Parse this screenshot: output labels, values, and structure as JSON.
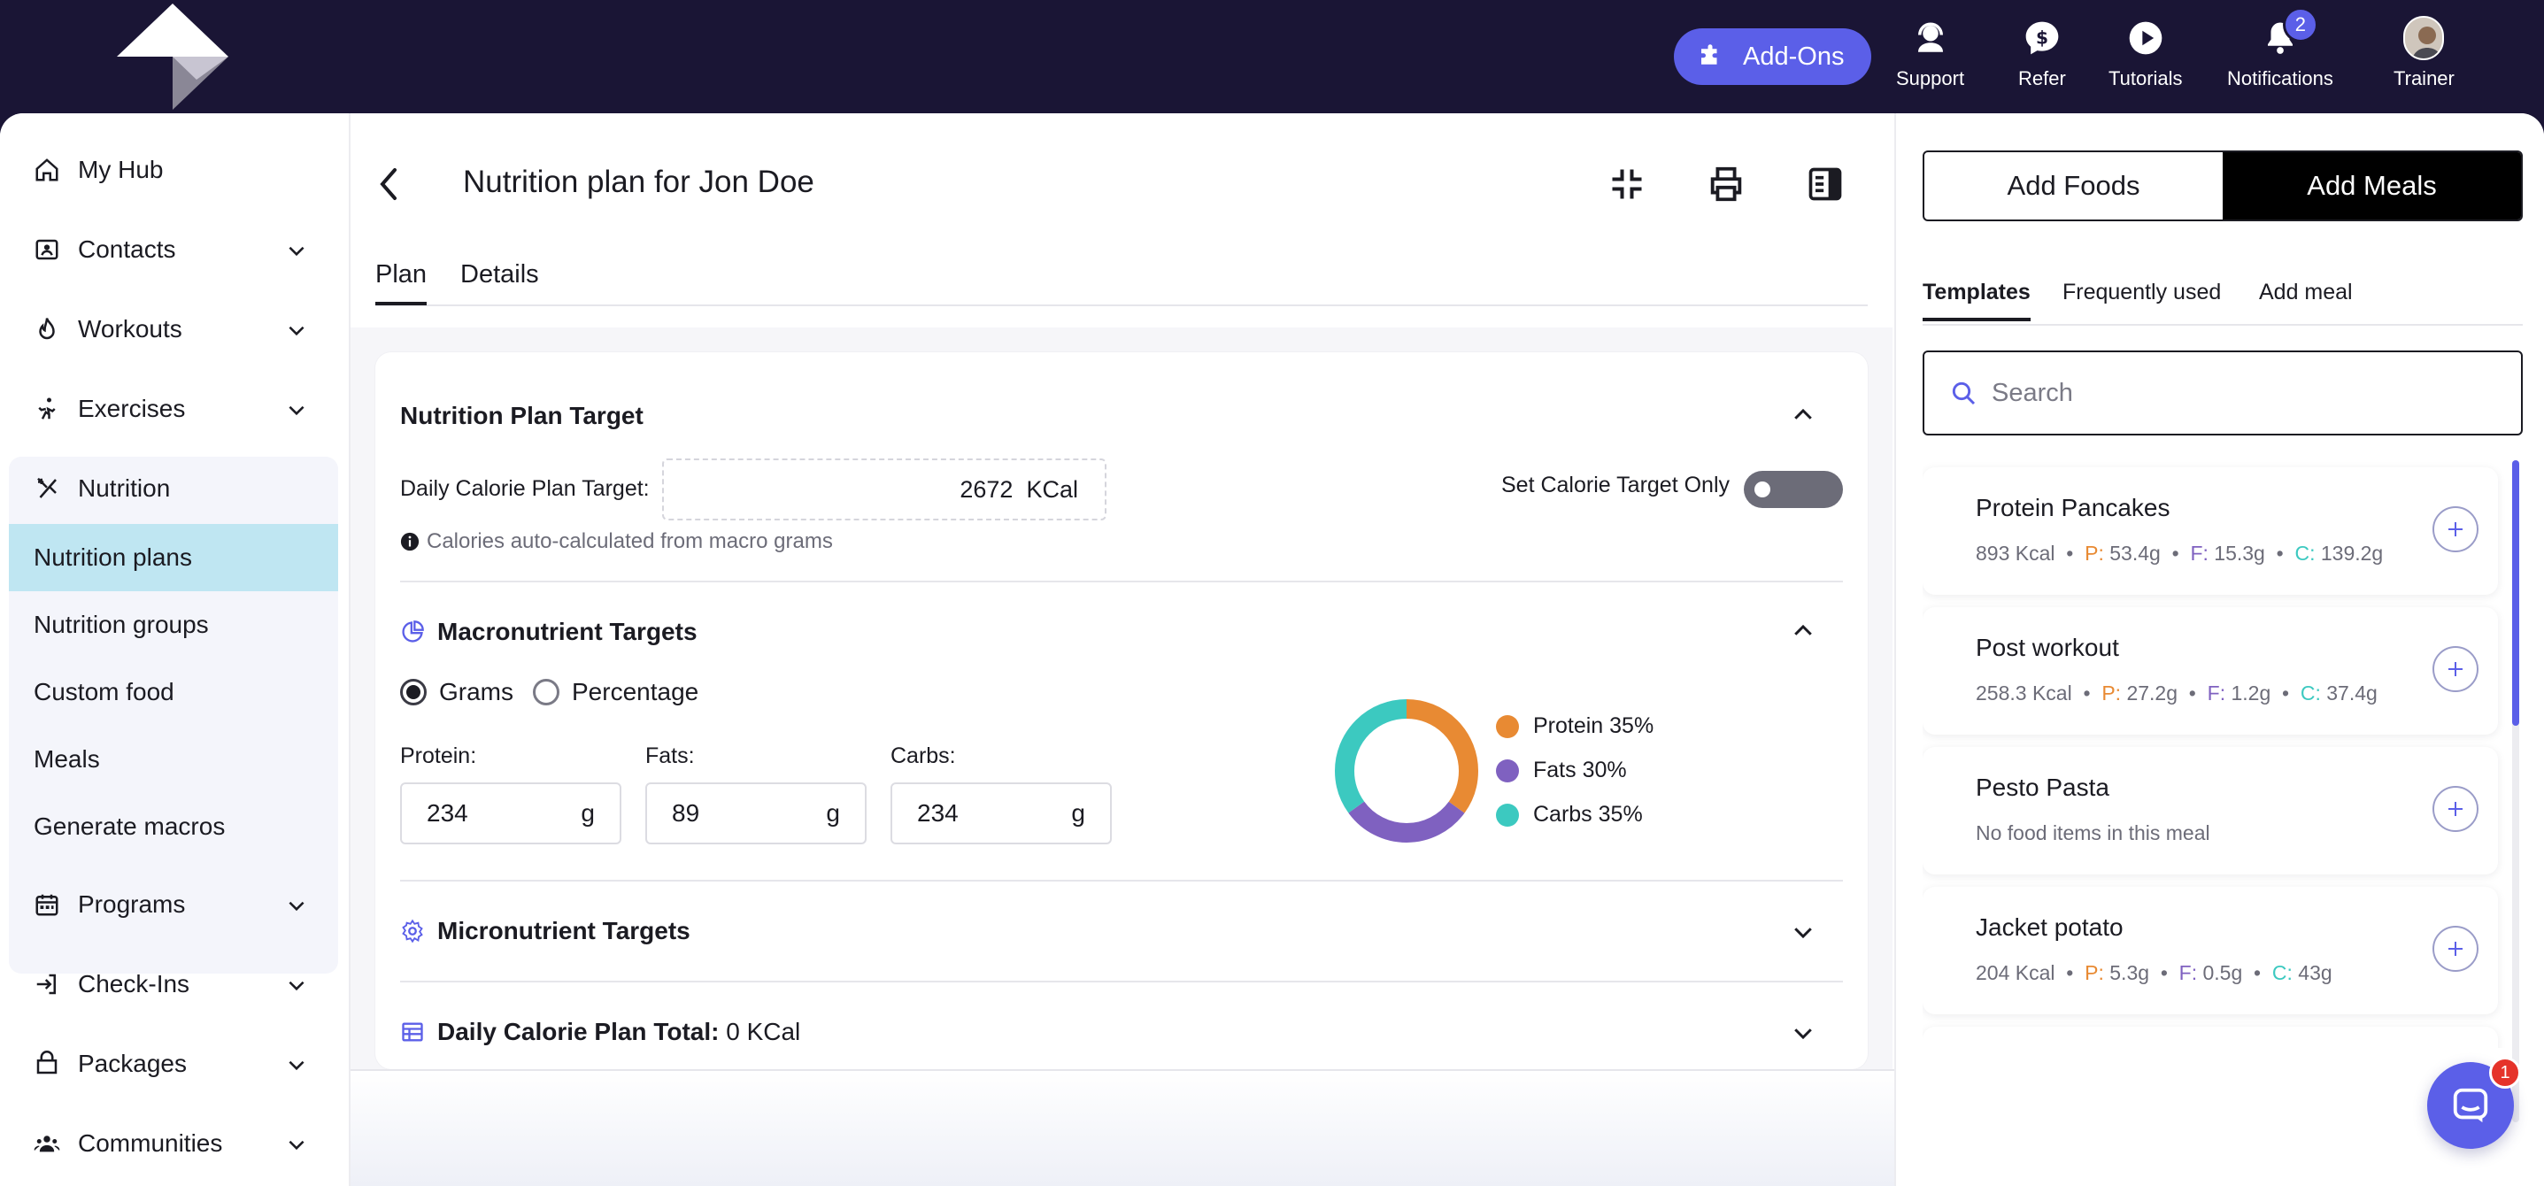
{
  "topbar": {
    "addons_label": "Add-Ons",
    "nav": [
      {
        "label": "Support"
      },
      {
        "label": "Refer"
      },
      {
        "label": "Tutorials"
      },
      {
        "label": "Notifications",
        "badge": "2"
      },
      {
        "label": "Trainer"
      }
    ]
  },
  "sidebar": {
    "items": [
      {
        "label": "My Hub",
        "icon": "home-icon"
      },
      {
        "label": "Contacts",
        "icon": "contacts-icon"
      },
      {
        "label": "Workouts",
        "icon": "workouts-icon"
      },
      {
        "label": "Exercises",
        "icon": "exercises-icon"
      },
      {
        "label": "Nutrition",
        "icon": "nutrition-icon"
      },
      {
        "label": "Programs",
        "icon": "calendar-icon"
      },
      {
        "label": "Check-Ins",
        "icon": "check-in-icon"
      },
      {
        "label": "Packages",
        "icon": "packages-icon"
      },
      {
        "label": "Communities",
        "icon": "communities-icon"
      }
    ],
    "nutrition_sub": [
      "Nutrition plans",
      "Nutrition groups",
      "Custom food",
      "Meals",
      "Generate macros"
    ],
    "active_sub": "Nutrition plans"
  },
  "main": {
    "title": "Nutrition plan for Jon Doe",
    "tabs": [
      "Plan",
      "Details"
    ],
    "active_tab": "Plan",
    "target": {
      "section_title": "Nutrition Plan Target",
      "calorie_label": "Daily Calorie Plan Target:",
      "calorie_value": "2672",
      "calorie_unit": "KCal",
      "hint": "Calories auto-calculated from macro grams",
      "toggle_label": "Set Calorie Target Only",
      "toggle_on": false
    },
    "macros": {
      "section_title": "Macronutrient Targets",
      "mode_options": [
        "Grams",
        "Percentage"
      ],
      "mode_selected": "Grams",
      "fields": [
        {
          "label": "Protein:",
          "value": "234",
          "unit": "g"
        },
        {
          "label": "Fats:",
          "value": "89",
          "unit": "g"
        },
        {
          "label": "Carbs:",
          "value": "234",
          "unit": "g"
        }
      ],
      "legend": [
        {
          "label": "Protein 35%",
          "pct": 35,
          "color": "#e88a33"
        },
        {
          "label": "Fats 30%",
          "pct": 30,
          "color": "#7f61c0"
        },
        {
          "label": "Carbs 35%",
          "pct": 35,
          "color": "#3cc9c0"
        }
      ]
    },
    "micro_title": "Micronutrient Targets",
    "daily_total_label": "Daily Calorie Plan Total:",
    "daily_total_value": "0 KCal"
  },
  "right_panel": {
    "segments": [
      "Add Foods",
      "Add Meals"
    ],
    "active_segment": "Add Meals",
    "tabs": [
      "Templates",
      "Frequently used",
      "Add meal"
    ],
    "active_tab": "Templates",
    "search_placeholder": "Search",
    "meals": [
      {
        "name": "Protein Pancakes",
        "kcal": "893 Kcal",
        "p": "53.4g",
        "f": "15.3g",
        "c": "139.2g"
      },
      {
        "name": "Post workout",
        "kcal": "258.3 Kcal",
        "p": "27.2g",
        "f": "1.2g",
        "c": "37.4g"
      },
      {
        "name": "Pesto Pasta",
        "empty": "No food items in this meal"
      },
      {
        "name": "Jacket potato",
        "kcal": "204 Kcal",
        "p": "5.3g",
        "f": "0.5g",
        "c": "43g"
      }
    ],
    "macro_prefix": {
      "p": "P:",
      "f": "F:",
      "c": "C:"
    },
    "separator": "•"
  },
  "chat_badge": "1",
  "colors": {
    "accent": "#5b5fe8",
    "protein": "#e88a33",
    "fats": "#7f61c0",
    "carbs": "#3cc9c0",
    "topbar": "#1a1535",
    "active_sub_bg": "#bfe6f2"
  }
}
